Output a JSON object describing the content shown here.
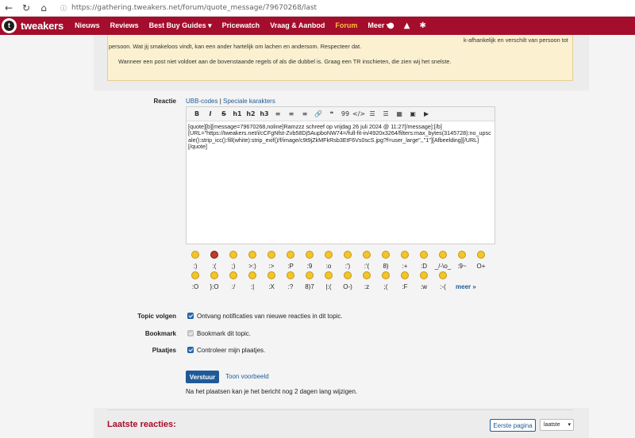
{
  "browser": {
    "back_icon": "arrow-left-icon",
    "reload_icon": "reload-icon",
    "home_icon": "home-icon",
    "url": "https://gathering.tweakers.net/forum/quote_message/79670268/last"
  },
  "site": {
    "logo_text": "tweakers",
    "logo_letter": "t",
    "nav": [
      "Nieuws",
      "Reviews",
      "Best Buy Guides ▾",
      "Pricewatch",
      "Vraag & Aanbod",
      "Forum",
      "Meer ▾"
    ],
    "active_nav": "Forum",
    "brand_color": "#a50d2c",
    "header_icons": [
      "chat-icon",
      "bell-icon",
      "settings-icon"
    ]
  },
  "rules": {
    "line1_tail": "k-afhankelijk en verschilt van persoon tot",
    "line2": "persoon. Wat jij smakeloos vindt, kan een ander hartelijk om lachen en andersom. Respecteer dat.",
    "line3": "Wanneer een post niet voldoet aan de bovenstaande regels of als die dubbel is. Graag een TR inschieten, die zien wij het snelste."
  },
  "form": {
    "reactie_label": "Reactie",
    "ubb_link": "UBB-codes",
    "separator": "|",
    "special_chars_link": "Speciale karakters",
    "toolbar": [
      "B",
      "I",
      "S",
      "h1",
      "h2",
      "h3",
      "≡",
      "≡",
      "≡",
      "🔗",
      "❝",
      "99",
      "</>",
      "☰",
      "☰",
      "▦",
      "▣",
      "▶"
    ],
    "message_text": "[quote][b][message=79670268,noline]Ramzzz schreef op vrijdag 26 juli 2024 @ 11:27[/message]:[/b]\n[URL=\"https://tweakers.net/i/cCFgNfst-Zvb58Dj5AupboNW74=/full-fit-in/4920x3264/filters:max_bytes(3145728):no_upscale():strip_icc():fill(white):strip_exif()/f/image/c9t9jZkMFkRsb3EtF6Vs0scS.jpg?f=user_large\",,\"1\"][Afbeelding][/URL]\n[/quote]",
    "smiley_codes_row1": [
      ":)",
      ":(",
      ";)",
      ">:)",
      ":>",
      ":P",
      ":9",
      ":o",
      ":')",
      ":'(",
      "8)",
      ":+",
      ":D",
      "_/-\\o_",
      ":9~",
      "O+"
    ],
    "smiley_codes_row2": [
      ":O",
      "}:O",
      ":/",
      ":|",
      ":X",
      ":?",
      "8)7",
      "|:(",
      "O-)",
      ":z",
      ";(",
      ":F",
      ":w",
      ":-(",
      "meer »"
    ],
    "topic_volgen_label": "Topic volgen",
    "topic_volgen_text": "Ontvang notificaties van nieuwe reacties in dit topic.",
    "bookmark_label": "Bookmark",
    "bookmark_text": "Bookmark dit topic.",
    "plaatjes_label": "Plaatjes",
    "plaatjes_text": "Controleer mijn plaatjes.",
    "submit_button": "Verstuur",
    "preview_link": "Toon voorbeeld",
    "note": "Na het plaatsen kan je het bericht nog 2 dagen lang wijzigen."
  },
  "latest": {
    "heading": "Laatste reacties:",
    "first_page_button": "Eerste pagina",
    "select_value": "laatste"
  }
}
